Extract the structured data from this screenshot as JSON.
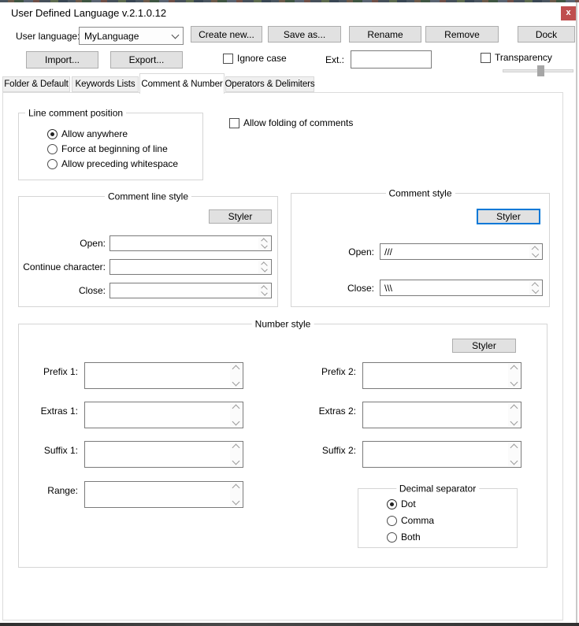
{
  "window": {
    "title": "User Defined Language v.2.1.0.12",
    "close_label": "x"
  },
  "toolbar": {
    "user_language_label": "User language:",
    "language_value": "MyLanguage",
    "create_new": "Create new...",
    "save_as": "Save as...",
    "rename": "Rename",
    "remove": "Remove",
    "dock": "Dock",
    "import": "Import...",
    "export": "Export...",
    "ignore_case": "Ignore case",
    "ext_label": "Ext.:",
    "ext_value": "",
    "transparency": "Transparency"
  },
  "tabs": [
    {
      "label": "Folder & Default",
      "active": false
    },
    {
      "label": "Keywords Lists",
      "active": false
    },
    {
      "label": "Comment & Number",
      "active": true
    },
    {
      "label": "Operators & Delimiters",
      "active": false
    }
  ],
  "line_comment_position": {
    "title": "Line comment position",
    "options": [
      "Allow anywhere",
      "Force at beginning of line",
      "Allow preceding whitespace"
    ],
    "selected": "Allow anywhere"
  },
  "allow_folding_label": "Allow folding of comments",
  "comment_line_style": {
    "title": "Comment line style",
    "styler_label": "Styler",
    "fields": [
      {
        "label": "Open:",
        "value": ""
      },
      {
        "label": "Continue character:",
        "value": ""
      },
      {
        "label": "Close:",
        "value": ""
      }
    ]
  },
  "comment_style": {
    "title": "Comment style",
    "styler_label": "Styler",
    "fields": [
      {
        "label": "Open:",
        "value": "///"
      },
      {
        "label": "Close:",
        "value": "\\\\\\"
      }
    ]
  },
  "number_style": {
    "title": "Number style",
    "styler_label": "Styler",
    "left_fields": [
      {
        "label": "Prefix 1:",
        "value": ""
      },
      {
        "label": "Extras 1:",
        "value": ""
      },
      {
        "label": "Suffix 1:",
        "value": ""
      },
      {
        "label": "Range:",
        "value": ""
      }
    ],
    "right_fields": [
      {
        "label": "Prefix 2:",
        "value": ""
      },
      {
        "label": "Extras 2:",
        "value": ""
      },
      {
        "label": "Suffix 2:",
        "value": ""
      }
    ],
    "decimal_separator": {
      "title": "Decimal separator",
      "options": [
        "Dot",
        "Comma",
        "Both"
      ],
      "selected": "Dot"
    }
  },
  "colors": {
    "close_button": "#bf4e4e",
    "focus_border": "#0078d7"
  }
}
